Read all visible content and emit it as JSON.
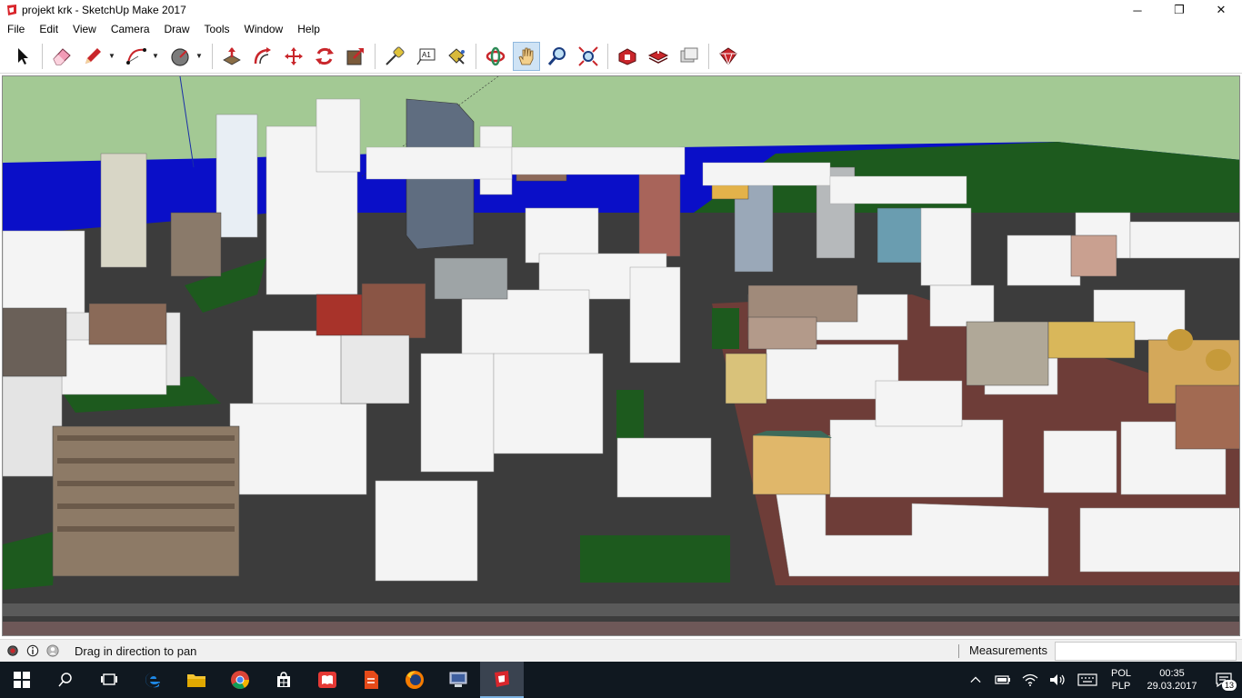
{
  "window": {
    "title": "projekt krk - SketchUp Make 2017",
    "minimize": "─",
    "maximize": "❐",
    "close": "✕"
  },
  "menu": [
    "File",
    "Edit",
    "View",
    "Camera",
    "Draw",
    "Tools",
    "Window",
    "Help"
  ],
  "toolbar": {
    "tools": [
      {
        "name": "select-tool",
        "icon": "arrow-icon"
      },
      {
        "name": "eraser-tool",
        "icon": "eraser-icon"
      },
      {
        "name": "line-tool",
        "icon": "pencil-icon"
      },
      {
        "name": "arc-tool",
        "icon": "arc-icon"
      },
      {
        "name": "shapes-tool",
        "icon": "circle-icon"
      },
      {
        "name": "push-pull-tool",
        "icon": "push-pull-icon"
      },
      {
        "name": "offset-tool",
        "icon": "offset-icon"
      },
      {
        "name": "move-tool",
        "icon": "move-icon"
      },
      {
        "name": "rotate-tool",
        "icon": "rotate-icon"
      },
      {
        "name": "scale-tool",
        "icon": "scale-icon"
      },
      {
        "name": "tape-measure-tool",
        "icon": "tape-icon"
      },
      {
        "name": "text-tool",
        "icon": "text-icon",
        "label": "A1"
      },
      {
        "name": "paint-bucket-tool",
        "icon": "paint-bucket-icon"
      },
      {
        "name": "orbit-tool",
        "icon": "orbit-icon"
      },
      {
        "name": "pan-tool",
        "icon": "hand-icon",
        "active": true
      },
      {
        "name": "zoom-tool",
        "icon": "magnifier-icon"
      },
      {
        "name": "zoom-extents-tool",
        "icon": "zoom-extents-icon"
      },
      {
        "name": "3d-warehouse-tool",
        "icon": "warehouse-icon"
      },
      {
        "name": "share-model-tool",
        "icon": "share-model-icon"
      },
      {
        "name": "share-component-tool",
        "icon": "share-component-icon"
      },
      {
        "name": "extension-warehouse-tool",
        "icon": "extension-icon"
      }
    ]
  },
  "status": {
    "message": "Drag in direction to pan",
    "measurements_label": "Measurements",
    "measurements_value": ""
  },
  "taskbar": {
    "apps": [
      {
        "name": "start-button",
        "icon": "windows-icon"
      },
      {
        "name": "search-button",
        "icon": "search-icon"
      },
      {
        "name": "task-view-button",
        "icon": "task-view-icon"
      },
      {
        "name": "edge-button",
        "icon": "edge-icon"
      },
      {
        "name": "file-explorer-button",
        "icon": "folder-icon"
      },
      {
        "name": "chrome-button",
        "icon": "chrome-icon"
      },
      {
        "name": "store-button",
        "icon": "store-icon"
      },
      {
        "name": "reader-button",
        "icon": "book-icon"
      },
      {
        "name": "wps-button",
        "icon": "document-icon"
      },
      {
        "name": "firefox-button",
        "icon": "firefox-icon"
      },
      {
        "name": "network-app-button",
        "icon": "computer-icon"
      },
      {
        "name": "sketchup-button",
        "icon": "sketchup-icon",
        "active": true
      }
    ],
    "language_top": "POL",
    "language_bottom": "PLP",
    "time": "00:35",
    "date": "29.03.2017",
    "notifications": "13"
  },
  "colors": {
    "sky": "#a3c994",
    "water": "#0a0fc8",
    "road": "#3c3c3c",
    "grass": "#1d5a1e",
    "building": "#f4f4f4",
    "plaza": "#6e3d38",
    "accent": "#cfe3f5"
  }
}
